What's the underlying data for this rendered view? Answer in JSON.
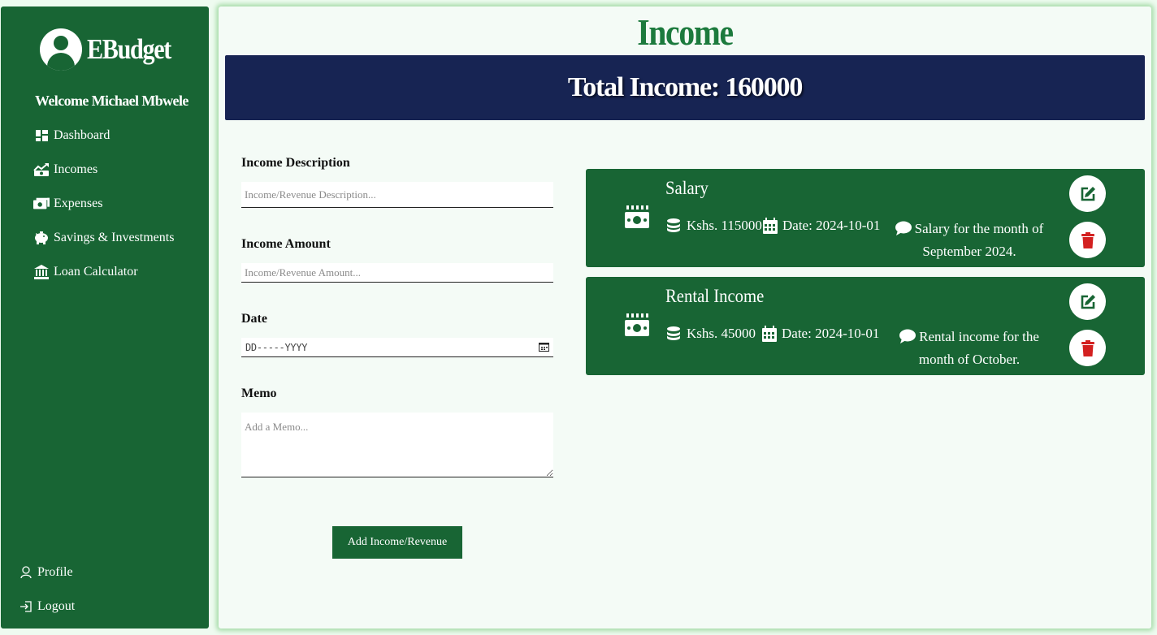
{
  "sidebar": {
    "brand": "EBudget",
    "welcome": "Welcome Michael Mbwele",
    "items": [
      {
        "label": "Dashboard",
        "icon": "dashboard-icon"
      },
      {
        "label": "Incomes",
        "icon": "chart-line-icon"
      },
      {
        "label": "Expenses",
        "icon": "money-bill-icon"
      },
      {
        "label": "Savings & Investments",
        "icon": "piggy-bank-icon"
      },
      {
        "label": "Loan Calculator",
        "icon": "bank-icon"
      }
    ],
    "bottom_items": [
      {
        "label": "Profile",
        "icon": "user-icon"
      },
      {
        "label": "Logout",
        "icon": "logout-icon"
      }
    ]
  },
  "main": {
    "title": "Income",
    "total_label": "Total Income: 160000"
  },
  "form": {
    "description_label": "Income Description",
    "description_placeholder": "Income/Revenue Description...",
    "amount_label": "Income Amount",
    "amount_placeholder": "Income/Revenue Amount...",
    "date_label": "Date",
    "date_placeholder": "DD-----YYYY",
    "memo_label": "Memo",
    "memo_placeholder": "Add a Memo...",
    "submit_label": "Add Income/Revenue"
  },
  "incomes": [
    {
      "title": "Salary",
      "amount": "Kshs. 115000",
      "date": "Date: 2024-10-01",
      "memo_line1": "Salary for the month of",
      "memo_line2": "September 2024."
    },
    {
      "title": "Rental Income",
      "amount": "Kshs. 45000",
      "date": "Date: 2024-10-01",
      "memo_line1": "Rental income for the",
      "memo_line2": "month of October."
    }
  ],
  "colors": {
    "sidebar": "#186534",
    "banner": "#172453",
    "title": "#1c7a3d",
    "edit": "#186534",
    "delete": "#d32020"
  }
}
